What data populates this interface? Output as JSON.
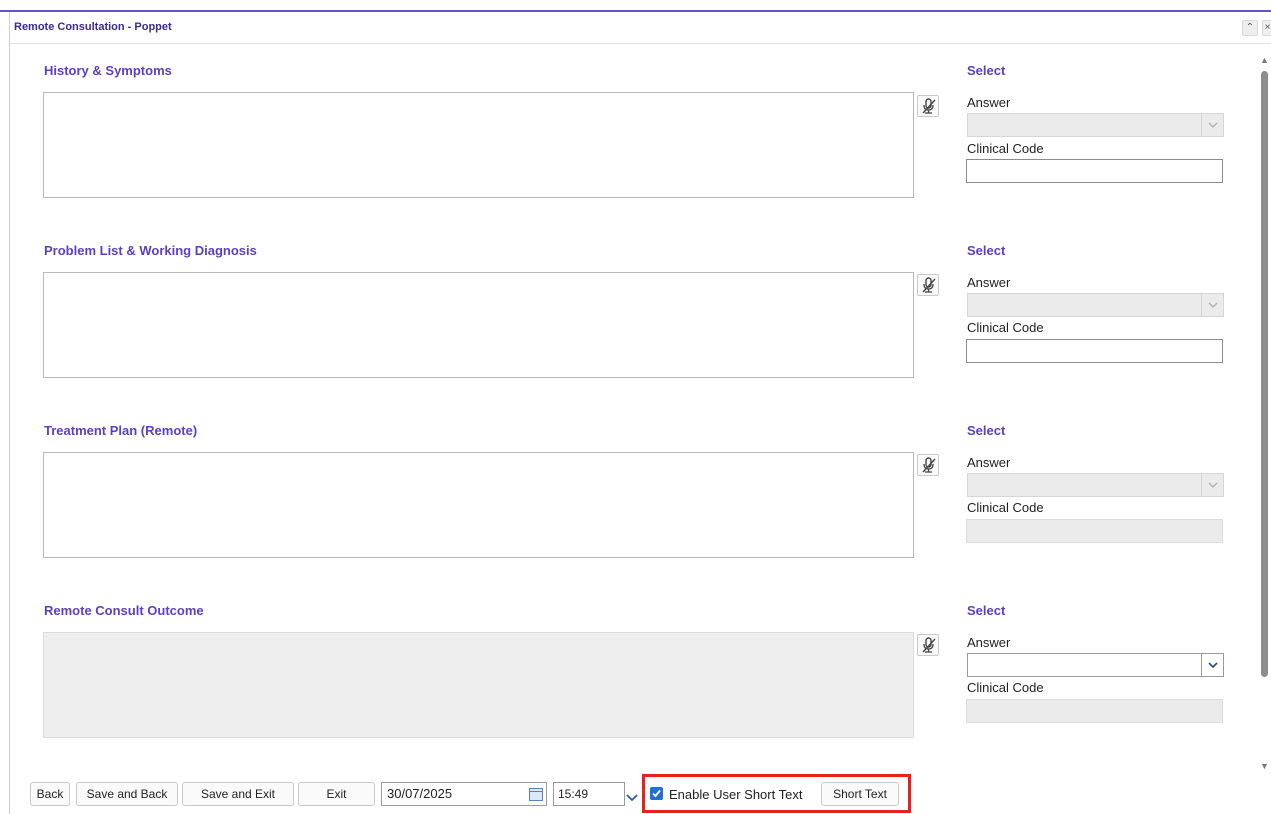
{
  "window": {
    "title": "Remote Consultation - Poppet",
    "collapse_icon": "chevron-up-icon",
    "close_icon": "close-icon"
  },
  "sections": [
    {
      "title": "History & Symptoms",
      "text": "",
      "select_title": "Select",
      "answer_label": "Answer",
      "answer_value": "",
      "code_label": "Clinical Code",
      "code_value": ""
    },
    {
      "title": "Problem List & Working Diagnosis",
      "text": "",
      "select_title": "Select",
      "answer_label": "Answer",
      "answer_value": "",
      "code_label": "Clinical Code",
      "code_value": ""
    },
    {
      "title": "Treatment Plan (Remote)",
      "text": "",
      "select_title": "Select",
      "answer_label": "Answer",
      "answer_value": "",
      "code_label": "Clinical Code",
      "code_value": ""
    },
    {
      "title": "Remote Consult Outcome",
      "text": "",
      "select_title": "Select",
      "answer_label": "Answer",
      "answer_value": "",
      "code_label": "Clinical Code",
      "code_value": ""
    }
  ],
  "footer": {
    "back_label": "Back",
    "save_back_label": "Save and Back",
    "save_exit_label": "Save and Exit",
    "exit_label": "Exit",
    "date_value": "30/07/2025",
    "time_value": "15:49",
    "enable_short_text_label": "Enable User Short Text",
    "enable_short_text_checked": true,
    "short_text_label": "Short Text"
  },
  "colors": {
    "accent": "#5b3fc4",
    "title": "#3b2a8f",
    "highlight": "#e8201f",
    "checkbox": "#1f6fd6"
  }
}
